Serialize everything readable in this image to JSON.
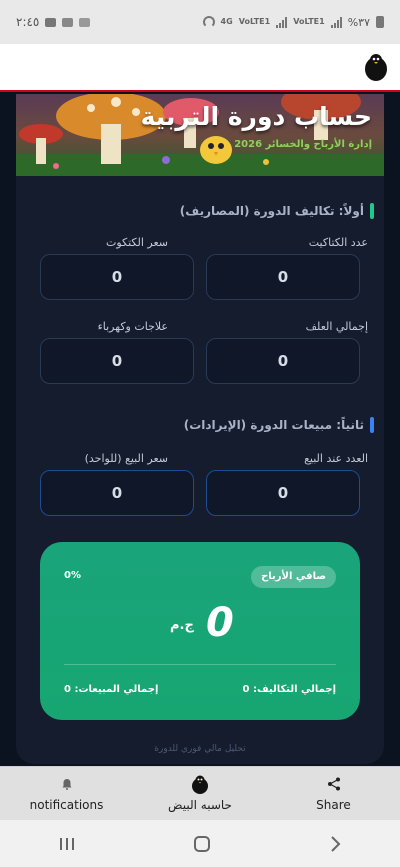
{
  "status_bar": {
    "time": "٢:٤٥",
    "battery": "%٣٧",
    "network_1": "VoLTE1",
    "network_2": "VoLTE1",
    "network_3": "4G"
  },
  "hero": {
    "title": "حساب دورة التربية",
    "subtitle": "إدارة الأرباح والخسائر 2026"
  },
  "costs": {
    "section_title": "أولاً: تكاليف الدورة (المصاريف)",
    "chicks_count_label": "عدد الكتاكيت",
    "chick_price_label": "سعر الكتكوت",
    "feed_total_label": "إجمالي العلف",
    "meds_electric_label": "علاجات وكهرباء",
    "chicks_count_value": "0",
    "chick_price_value": "0",
    "feed_total_value": "0",
    "meds_electric_value": "0"
  },
  "sales": {
    "section_title": "ثانياً: مبيعات الدورة (الإيرادات)",
    "sold_count_label": "العدد عند البيع",
    "unit_price_label": "سعر البيع (للواحد)",
    "sold_count_value": "0",
    "unit_price_value": "0"
  },
  "profit": {
    "badge": "صافي الأرباح",
    "percent": "0%",
    "amount": "0",
    "currency": "ج.م",
    "total_costs": "إجمالي التكاليف: 0",
    "total_sales": "إجمالي المبيعات: 0"
  },
  "footer_note": "تحليل مالي فوري للدورة",
  "bottom_nav": {
    "notifications": "notifications",
    "egg_calc": "حاسبه البيض",
    "share": "Share"
  },
  "colors": {
    "accent_green": "#1ec98a",
    "accent_blue": "#3b82f6",
    "profit_card": "#17a672",
    "appbar_border": "#d0021b"
  }
}
